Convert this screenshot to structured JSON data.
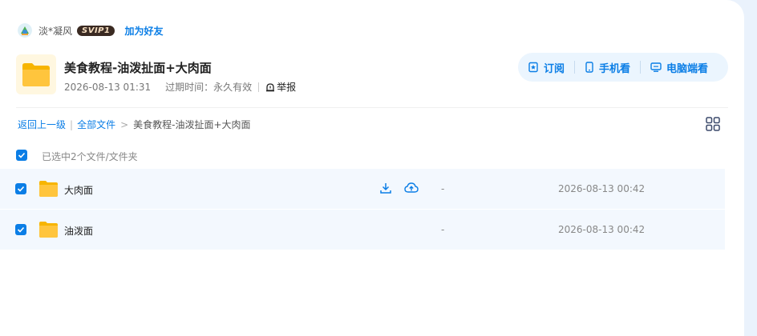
{
  "header": {
    "username": "淡*凝风",
    "badge": "SVIP1",
    "add_friend": "加为好友"
  },
  "share": {
    "title": "美食教程-油泼扯面+大肉面",
    "date": "2026-08-13 01:31",
    "expire_label": "过期时间：",
    "expire_value": "永久有效",
    "report": "举报"
  },
  "actions": {
    "subscribe": "订阅",
    "mobile": "手机看",
    "desktop": "电脑端看"
  },
  "breadcrumb": {
    "back": "返回上一级",
    "all_files": "全部文件",
    "current": "美食教程-油泼扯面+大肉面"
  },
  "selection": {
    "text": "已选中2个文件/文件夹"
  },
  "files": [
    {
      "name": "大肉面",
      "size": "-",
      "time": "2026-08-13 00:42"
    },
    {
      "name": "油泼面",
      "size": "-",
      "time": "2026-08-13 00:42"
    }
  ],
  "colors": {
    "accent": "#0b7ee6",
    "folder": "#ffc53d",
    "row_bg": "#f3f8fe",
    "page_bg": "#eaf2fc"
  }
}
